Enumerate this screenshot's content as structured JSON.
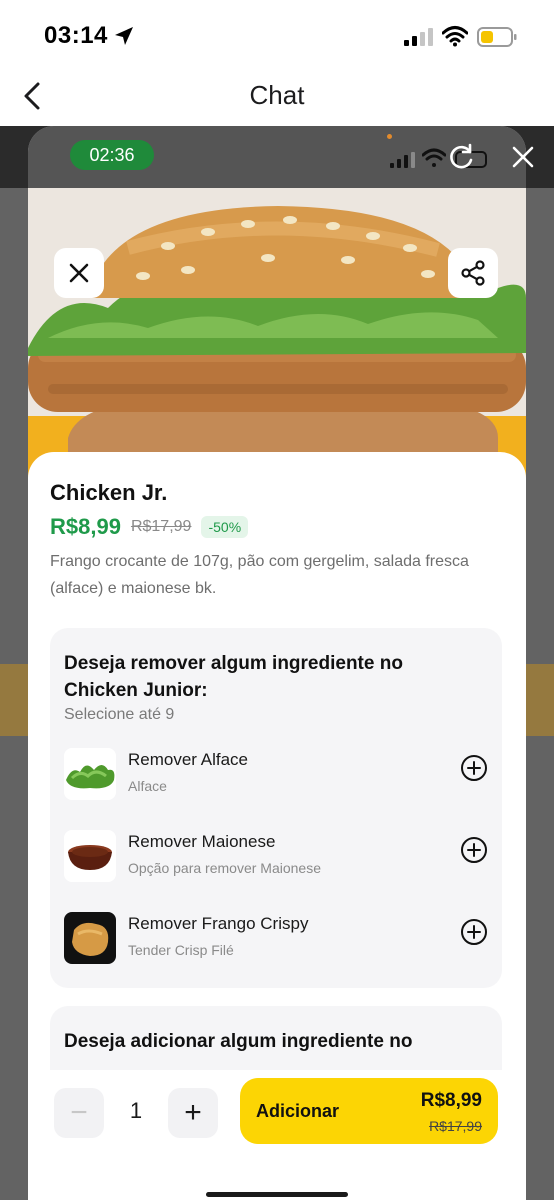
{
  "status_bar": {
    "time": "03:14"
  },
  "nav": {
    "title": "Chat"
  },
  "inner": {
    "time": "02:36",
    "product": {
      "name": "Chicken Jr.",
      "price": "R$8,99",
      "old_price": "R$17,99",
      "discount": "-50%",
      "description": "Frango crocante de 107g, pão com gergelim, salada fresca (alface) e maionese bk."
    },
    "remove_section": {
      "title": "Deseja remover algum ingrediente no Chicken Junior:",
      "subtitle": "Selecione até 9",
      "options": [
        {
          "title": "Remover Alface",
          "subtitle": "Alface"
        },
        {
          "title": "Remover Maionese",
          "subtitle": "Opção para remover Maionese"
        },
        {
          "title": "Remover Frango Crispy",
          "subtitle": "Tender Crisp Filé"
        }
      ]
    },
    "add_section": {
      "title": "Deseja adicionar algum ingrediente no"
    },
    "footer": {
      "quantity": "1",
      "minus": "−",
      "plus": "+",
      "add_label": "Adicionar",
      "add_price": "R$8,99",
      "add_old_price": "R$17,99"
    }
  },
  "colors": {
    "accent_yellow": "#fcd504",
    "price_green": "#1f9a4a",
    "timer_green": "#1f8a3a"
  }
}
